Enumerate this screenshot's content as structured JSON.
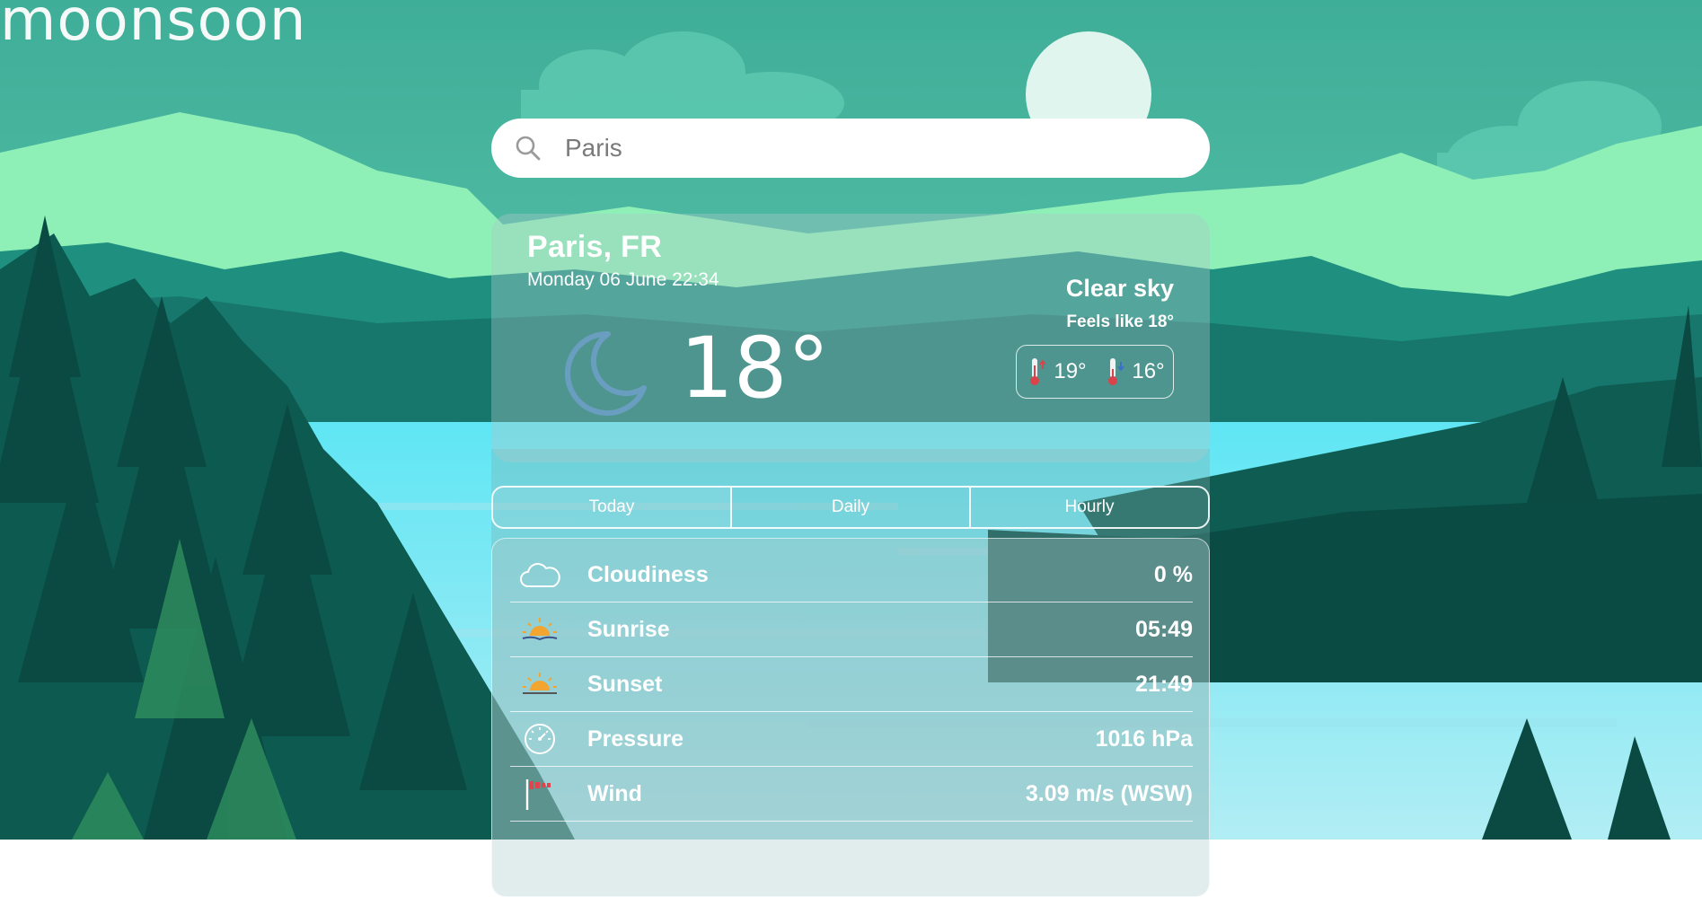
{
  "app": {
    "logo": "moonsoon"
  },
  "search": {
    "value": "Paris",
    "icon": "search-icon"
  },
  "current": {
    "city": "Paris, FR",
    "date": "Monday 06 June 22:34",
    "temperature": "18°",
    "condition": "Clear sky",
    "feels_like": "Feels like 18°",
    "max": "19°",
    "min": "16°",
    "icon": "moon-icon"
  },
  "tabs": [
    {
      "label": "Today"
    },
    {
      "label": "Daily"
    },
    {
      "label": "Hourly"
    }
  ],
  "details": [
    {
      "label": "Cloudiness",
      "value": "0 %",
      "icon": "cloud-icon"
    },
    {
      "label": "Sunrise",
      "value": "05:49",
      "icon": "sunrise-icon"
    },
    {
      "label": "Sunset",
      "value": "21:49",
      "icon": "sunset-icon"
    },
    {
      "label": "Pressure",
      "value": "1016 hPa",
      "icon": "gauge-icon"
    },
    {
      "label": "Wind",
      "value": "3.09 m/s (WSW)",
      "icon": "windsock-icon"
    }
  ],
  "colors": {
    "sky_top": "#4fb9a4",
    "mountains": "#8ff0b8",
    "lake": "#6fe3f2",
    "forest": "#0c5a50",
    "moon_icon": "#6a9ec0"
  }
}
